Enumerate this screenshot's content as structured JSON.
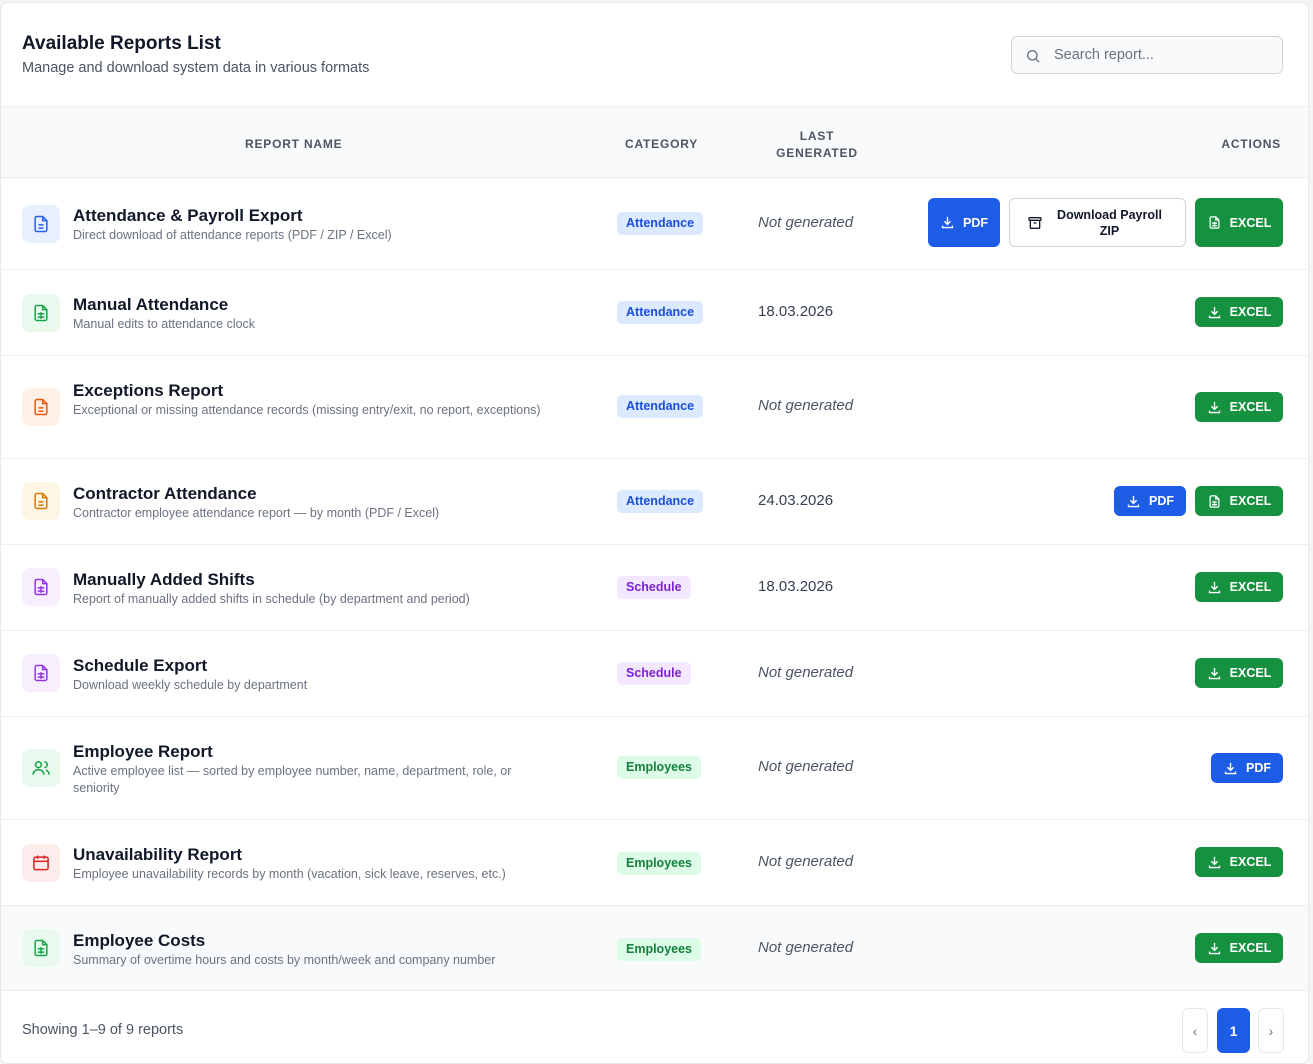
{
  "header": {
    "title": "Available Reports List",
    "subtitle": "Manage and download system data in various formats"
  },
  "search": {
    "placeholder": "Search report..."
  },
  "table": {
    "columns": [
      "Report Name",
      "Category",
      "Last Generated",
      "Actions"
    ]
  },
  "rows": [
    {
      "name": "Attendance & Payroll Export",
      "description": "Direct download of attendance reports (PDF / ZIP / Excel)",
      "category": "Attendance",
      "last_generated": "Not generated",
      "icon": "document-text-icon",
      "actions": [
        "PDF",
        "Download Payroll ZIP",
        "EXCEL"
      ]
    },
    {
      "name": "Manual Attendance",
      "description": "Manual edits to attendance clock",
      "category": "Attendance",
      "last_generated": "18.03.2026",
      "icon": "spreadsheet-icon",
      "actions": [
        "EXCEL"
      ]
    },
    {
      "name": "Exceptions Report",
      "description": "Exceptional or missing attendance records (missing entry/exit, no report, exceptions)",
      "category": "Attendance",
      "last_generated": "Not generated",
      "icon": "document-text-icon",
      "actions": [
        "EXCEL"
      ]
    },
    {
      "name": "Contractor Attendance",
      "description": "Contractor employee attendance report — by month (PDF / Excel)",
      "category": "Attendance",
      "last_generated": "24.03.2026",
      "icon": "document-text-icon",
      "actions": [
        "PDF",
        "EXCEL"
      ]
    },
    {
      "name": "Manually Added Shifts",
      "description": "Report of manually added shifts in schedule (by department and period)",
      "category": "Schedule",
      "last_generated": "18.03.2026",
      "icon": "spreadsheet-icon",
      "actions": [
        "EXCEL"
      ]
    },
    {
      "name": "Schedule Export",
      "description": "Download weekly schedule by department",
      "category": "Schedule",
      "last_generated": "Not generated",
      "icon": "spreadsheet-icon",
      "actions": [
        "EXCEL"
      ]
    },
    {
      "name": "Employee Report",
      "description": "Active employee list — sorted by employee number, name, department, role, or seniority",
      "category": "Employees",
      "last_generated": "Not generated",
      "icon": "users-icon",
      "actions": [
        "PDF"
      ]
    },
    {
      "name": "Unavailability Report",
      "description": "Employee unavailability records by month (vacation, sick leave, reserves, etc.)",
      "category": "Employees",
      "last_generated": "Not generated",
      "icon": "calendar-icon",
      "actions": [
        "EXCEL"
      ]
    },
    {
      "name": "Employee Costs",
      "description": "Summary of overtime hours and costs by month/week and company number",
      "category": "Employees",
      "last_generated": "Not generated",
      "icon": "spreadsheet-icon",
      "actions": [
        "EXCEL"
      ]
    }
  ],
  "footer": {
    "showing": "Showing 1–9 of 9 reports",
    "current_page": "1",
    "prev": "‹",
    "next": "›"
  },
  "colors": {
    "primary": "#1d5ce6",
    "excel": "#16913f",
    "attendance_badge": "#dbeafe",
    "schedule_badge": "#f3e8ff",
    "employees_badge": "#dcfce7"
  }
}
